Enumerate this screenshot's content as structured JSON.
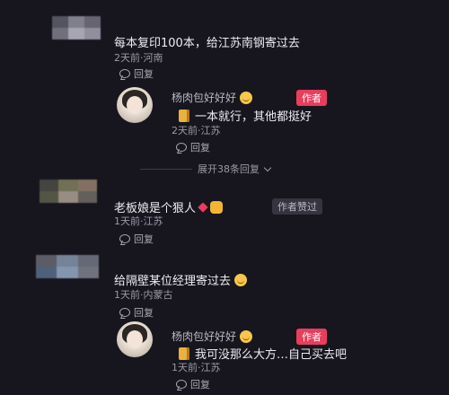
{
  "comments": [
    {
      "content": "每本复印100本，给江苏南钢寄过去",
      "meta": "2天前·河南",
      "reply_label": "回复",
      "replies": [
        {
          "username": "杨肉包好好好",
          "author_tag": "作者",
          "content": "一本就行，其他都挺好",
          "meta": "2天前·江苏",
          "reply_label": "回复"
        }
      ],
      "expand_label": "展开38条回复"
    },
    {
      "content": "老板娘是个狠人",
      "liked_tag": "作者赞过",
      "meta": "1天前·江苏",
      "reply_label": "回复"
    },
    {
      "content": "给隔壁某位经理寄过去",
      "meta": "1天前·内蒙古",
      "reply_label": "回复",
      "replies": [
        {
          "username": "杨肉包好好好",
          "author_tag": "作者",
          "content": "我可没那么大方…自己买去吧",
          "meta": "1天前·江苏",
          "reply_label": "回复"
        }
      ]
    }
  ],
  "icons": {
    "reply": "speech-bubble-icon",
    "smile": "smiley-emoji-icon",
    "sticker": "sticker-emoji-icon",
    "thumbs": "thumbs-up-emoji-icon",
    "chevron": "chevron-down-icon"
  },
  "colors": {
    "background": "#17161f",
    "author_tag": "#e83d5c",
    "meta_text": "#9a99a6"
  }
}
